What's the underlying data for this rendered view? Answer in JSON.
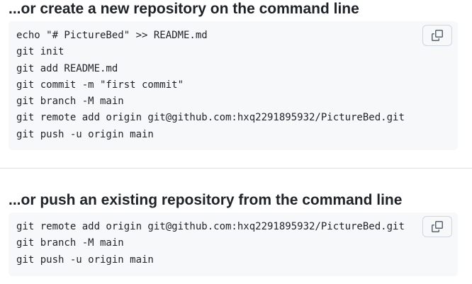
{
  "create_section": {
    "title": "...or create a new repository on the command line",
    "lines": [
      "echo \"# PictureBed\" >> README.md",
      "git init",
      "git add README.md",
      "git commit -m \"first commit\"",
      "git branch -M main",
      "git remote add origin git@github.com:hxq2291895932/PictureBed.git",
      "git push -u origin main"
    ],
    "copy_icon": "copy-icon"
  },
  "push_section": {
    "title": "...or push an existing repository from the command line",
    "lines": [
      "git remote add origin git@github.com:hxq2291895932/PictureBed.git",
      "git branch -M main",
      "git push -u origin main"
    ],
    "copy_icon": "copy-icon"
  },
  "colors": {
    "text": "#1f2328",
    "code_background": "#f6f8fa",
    "border": "#d0d7de",
    "divider": "#d8dee4",
    "icon": "#59636e"
  }
}
